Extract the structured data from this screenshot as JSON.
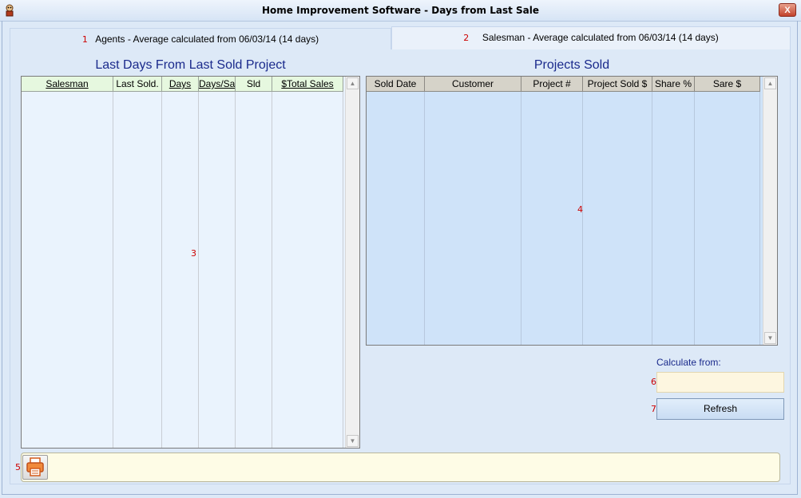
{
  "window": {
    "title": "Home Improvement Software - Days from Last Sale",
    "close_label": "X"
  },
  "tabs": [
    {
      "marker": "1",
      "label": "Agents - Average calculated from 06/03/14 (14 days)"
    },
    {
      "marker": "2",
      "label": "Salesman - Average calculated from 06/03/14 (14 days)"
    }
  ],
  "left_panel": {
    "title": "Last Days From Last Sold Project",
    "marker": "3",
    "columns": [
      "Salesman",
      "Last Sold.",
      "Days",
      "Days/Sa",
      "Sld",
      "$Total Sales"
    ]
  },
  "right_panel": {
    "title": "Projects Sold",
    "marker": "4",
    "columns": [
      "Sold Date",
      "Customer",
      "Project #",
      "Project Sold $",
      "Share %",
      "Sare $"
    ]
  },
  "calculate": {
    "label": "Calculate from:",
    "marker": "6",
    "value": ""
  },
  "refresh": {
    "marker": "7",
    "label": "Refresh"
  },
  "bottom": {
    "marker": "5"
  },
  "icons": {
    "app": "app-icon",
    "print": "print-icon"
  }
}
